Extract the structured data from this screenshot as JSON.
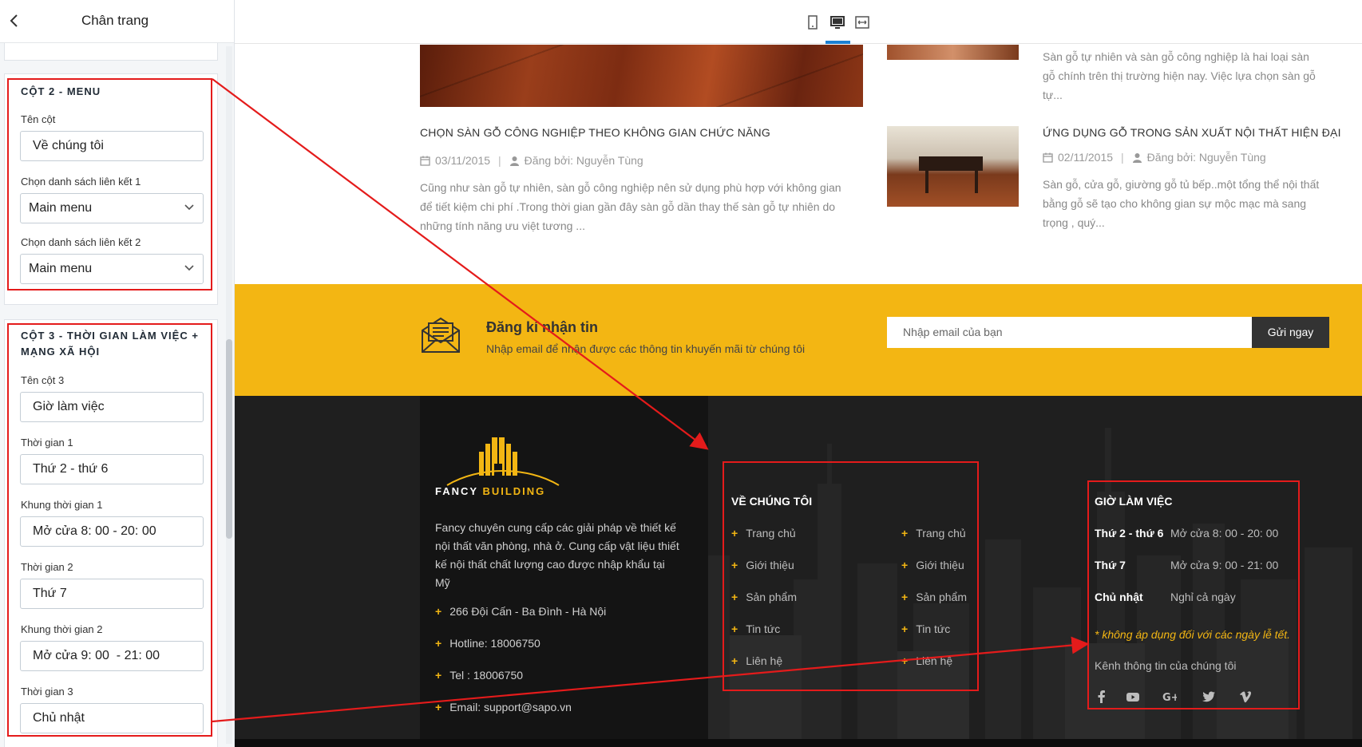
{
  "sidebar": {
    "title": "Chân trang",
    "col2": {
      "heading": "CỘT 2 - MENU",
      "name_label": "Tên cột",
      "name_value": "Về chúng tôi",
      "link1_label": "Chọn danh sách liên kết 1",
      "link1_value": "Main menu",
      "link2_label": "Chọn danh sách liên kết 2",
      "link2_value": "Main menu"
    },
    "col3": {
      "heading_line1": "CỘT 3 - THỜI GIAN LÀM VIỆC +",
      "heading_line2": "MẠNG XÃ HỘI",
      "name_label": "Tên cột 3",
      "name_value": "Giờ làm việc",
      "time1_label": "Thời gian 1",
      "time1_value": "Thứ 2 - thứ 6",
      "range1_label": "Khung thời gian 1",
      "range1_value": "Mở cửa 8: 00 - 20: 00",
      "time2_label": "Thời gian 2",
      "time2_value": "Thứ 7",
      "range2_label": "Khung thời gian 2",
      "range2_value": "Mở cửa 9: 00  - 21: 00",
      "time3_label": "Thời gian 3",
      "time3_value": "Chủ nhật"
    }
  },
  "topbar": {
    "devices": [
      "mobile-icon",
      "desktop-icon",
      "fullwidth-icon"
    ],
    "active": "desktop"
  },
  "posts": {
    "right_top_excerpt": [
      "Sàn gỗ tự nhiên và sàn gỗ công nghiệp là hai loại sàn",
      "gỗ chính trên thị trường hiện nay. Việc lựa chọn sàn gỗ",
      "tự..."
    ],
    "left": {
      "title": "CHỌN SÀN GỖ CÔNG NGHIỆP THEO KHÔNG GIAN CHỨC NĂNG",
      "date": "03/11/2015",
      "author": "Đăng bởi: Nguyễn Tùng",
      "excerpt": [
        "Cũng như sàn gỗ tự nhiên, sàn gỗ công nghiệp nên sử dụng phù hợp với không gian",
        "để tiết kiệm chi phí .Trong thời gian gần đây sàn gỗ dần thay thế sàn gỗ tự nhiên do",
        "những tính năng ưu việt tương ..."
      ]
    },
    "right": {
      "title": "ỨNG DỤNG GỖ TRONG SẢN XUẤT NỘI THẤT HIỆN ĐẠI",
      "date": "02/11/2015",
      "author": "Đăng bởi: Nguyễn Tùng",
      "excerpt": [
        "Sàn gỗ, cửa gỗ, giường gỗ tủ bếp..một tổng thể nội thất",
        "bằng gỗ sẽ tạo cho không gian sự mộc mạc mà sang",
        "trọng , quý..."
      ]
    }
  },
  "newsletter": {
    "title": "Đăng kí nhận tin",
    "subtitle": "Nhập email để nhận được các thông tin khuyến mãi từ chúng tôi",
    "placeholder": "Nhập email của bạn",
    "button": "Gửi ngay"
  },
  "footer": {
    "logo_word1": "FANCY",
    "logo_word2": "BUILDING",
    "description": [
      "Fancy chuyên cung cấp các giải pháp về thiết kế",
      "nội thất văn phòng, nhà ở. Cung cấp vật liệu thiết",
      "kế nội thất chất lượng cao được nhập khẩu tại",
      "Mỹ"
    ],
    "contacts": [
      "266 Đội Cấn - Ba Đình - Hà Nội",
      "Hotline: 18006750",
      "Tel : 18006750",
      "Email: support@sapo.vn"
    ],
    "bullet": "+",
    "menu_title": "VỀ CHÚNG TÔI",
    "menu_col_a": [
      "Trang chủ",
      "Giới thiệu",
      "Sản phẩm",
      "Tin tức",
      "Liên hệ"
    ],
    "menu_col_b": [
      "Trang chủ",
      "Giới thiệu",
      "Sản phẩm",
      "Tin tức",
      "Liên hệ"
    ],
    "hours_title": "GIỜ LÀM VIỆC",
    "hours": [
      {
        "day": "Thứ 2 - thứ 6",
        "time": "Mở cửa 8: 00 - 20: 00"
      },
      {
        "day": "Thứ 7",
        "time": "Mở cửa 9: 00 - 21: 00"
      },
      {
        "day": "Chủ nhật",
        "time": "Nghỉ cả ngày"
      }
    ],
    "note": "* không áp dụng đối với các ngày lễ tết.",
    "channel": "Kênh thông tin của chúng tôi",
    "social": [
      "facebook-icon",
      "youtube-icon",
      "google-plus-icon",
      "twitter-icon",
      "vimeo-icon"
    ]
  },
  "colors": {
    "accent_yellow": "#f3b613",
    "annotation_red": "#e41b1b",
    "device_active": "#1a80d3"
  }
}
